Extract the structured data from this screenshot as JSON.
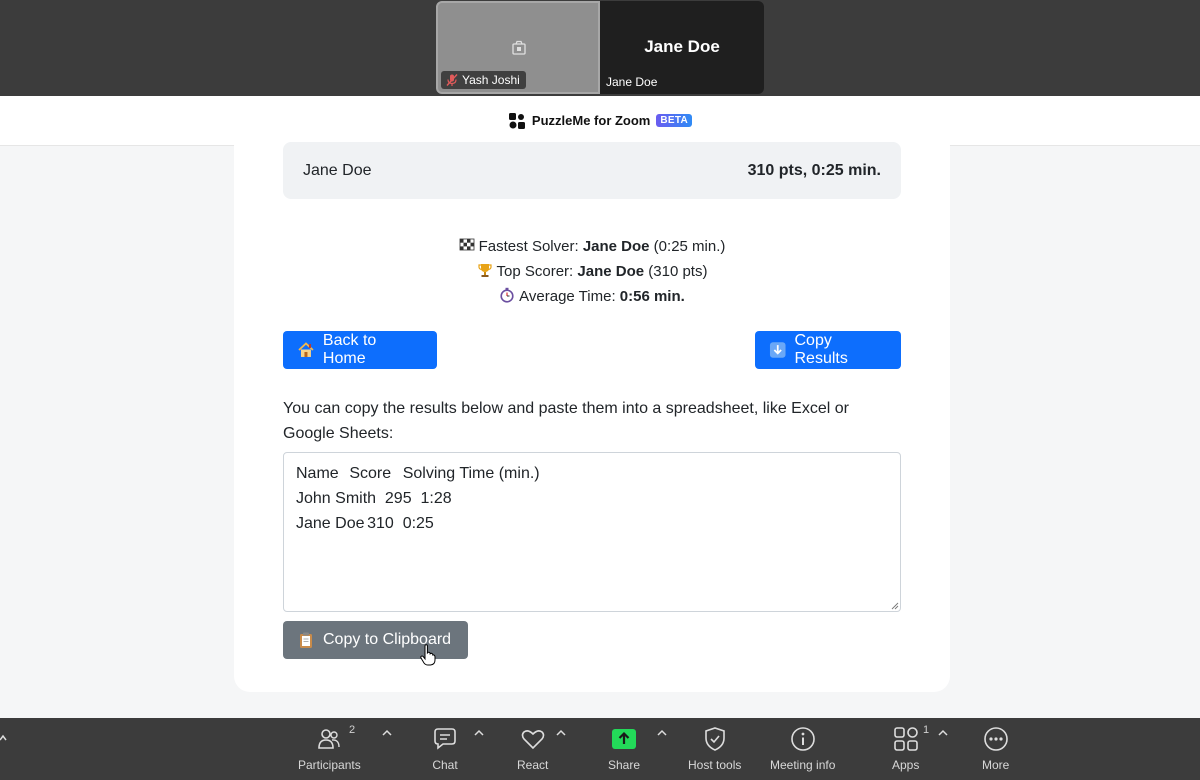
{
  "video": {
    "tile1_name": "Yash Joshi",
    "tile2_big_name": "Jane Doe",
    "tile2_name": "Jane Doe"
  },
  "app": {
    "title": "PuzzleMe for Zoom",
    "badge": "BETA"
  },
  "results_row": {
    "name": "Jane Doe",
    "score": "310 pts, 0:25 min."
  },
  "stats": {
    "fastest_label": "Fastest Solver: ",
    "fastest_name": "Jane Doe",
    "fastest_time": " (0:25 min.)",
    "top_label": "Top Scorer: ",
    "top_name": "Jane Doe",
    "top_points": " (310 pts)",
    "avg_label": "Average Time: ",
    "avg_value": "0:56 min."
  },
  "buttons": {
    "back_home": "Back to Home",
    "copy_results": "Copy Results",
    "copy_clipboard": "Copy to Clipboard"
  },
  "helper_text": "You can copy the results below and paste them into a spreadsheet, like Excel or Google Sheets:",
  "results_text": "Name\tScore\tSolving Time (min.)\nJohn Smith\t295\t1:28\nJane Doe\t310\t0:25",
  "toolbar": {
    "participants": "Participants",
    "participants_count": "2",
    "chat": "Chat",
    "react": "React",
    "share": "Share",
    "host_tools": "Host tools",
    "meeting_info": "Meeting info",
    "apps": "Apps",
    "apps_count": "1",
    "more": "More"
  },
  "colors": {
    "primary": "#0d6efd",
    "secondary": "#6c757d",
    "share_green": "#23d959",
    "toolbar_bg": "#3c3c3c"
  }
}
